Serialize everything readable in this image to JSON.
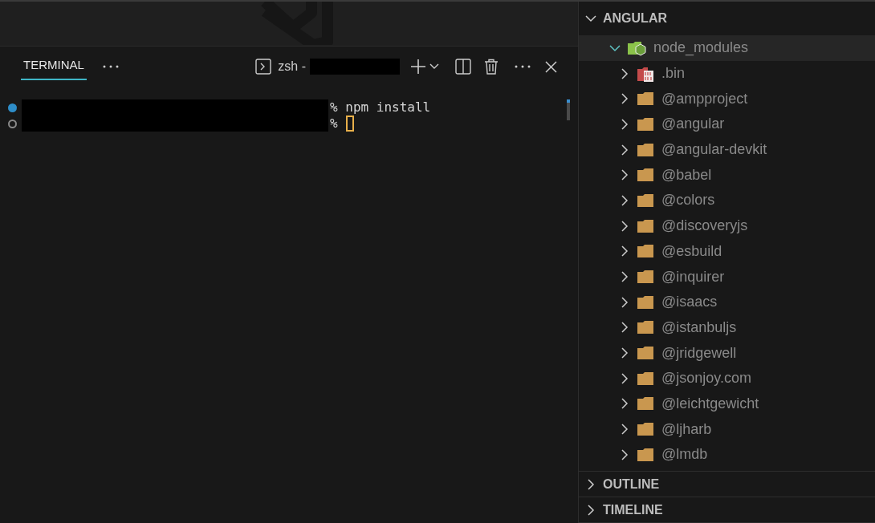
{
  "terminal": {
    "tabs": [
      {
        "label": "TERMINAL",
        "selected": true
      }
    ],
    "shell": "zsh -",
    "lines": [
      {
        "kind": "done",
        "prompt": "%",
        "command": "npm install"
      },
      {
        "kind": "pending",
        "prompt": "%"
      }
    ]
  },
  "explorer": {
    "sections": [
      {
        "title": "ANGULAR",
        "expanded": true,
        "tree": [
          {
            "name": "node_modules",
            "kind": "node",
            "expanded": true,
            "selected": true,
            "children": [
              {
                "name": ".bin",
                "kind": "binary",
                "expanded": false,
                "selected": false
              },
              {
                "name": "@ampproject",
                "kind": "folder",
                "expanded": false,
                "selected": false
              },
              {
                "name": "@angular",
                "kind": "folder",
                "expanded": false,
                "selected": false
              },
              {
                "name": "@angular-devkit",
                "kind": "folder",
                "expanded": false,
                "selected": false
              },
              {
                "name": "@babel",
                "kind": "folder",
                "expanded": false,
                "selected": false
              },
              {
                "name": "@colors",
                "kind": "folder",
                "expanded": false,
                "selected": false
              },
              {
                "name": "@discoveryjs",
                "kind": "folder",
                "expanded": false,
                "selected": false
              },
              {
                "name": "@esbuild",
                "kind": "folder",
                "expanded": false,
                "selected": false
              },
              {
                "name": "@inquirer",
                "kind": "folder",
                "expanded": false,
                "selected": false
              },
              {
                "name": "@isaacs",
                "kind": "folder",
                "expanded": false,
                "selected": false
              },
              {
                "name": "@istanbuljs",
                "kind": "folder",
                "expanded": false,
                "selected": false
              },
              {
                "name": "@jridgewell",
                "kind": "folder",
                "expanded": false,
                "selected": false
              },
              {
                "name": "@jsonjoy.com",
                "kind": "folder",
                "expanded": false,
                "selected": false
              },
              {
                "name": "@leichtgewicht",
                "kind": "folder",
                "expanded": false,
                "selected": false
              },
              {
                "name": "@ljharb",
                "kind": "folder",
                "expanded": false,
                "selected": false
              },
              {
                "name": "@lmdb",
                "kind": "folder",
                "expanded": false,
                "selected": false
              }
            ]
          }
        ]
      },
      {
        "title": "OUTLINE",
        "expanded": false
      },
      {
        "title": "TIMELINE",
        "expanded": false
      }
    ]
  }
}
